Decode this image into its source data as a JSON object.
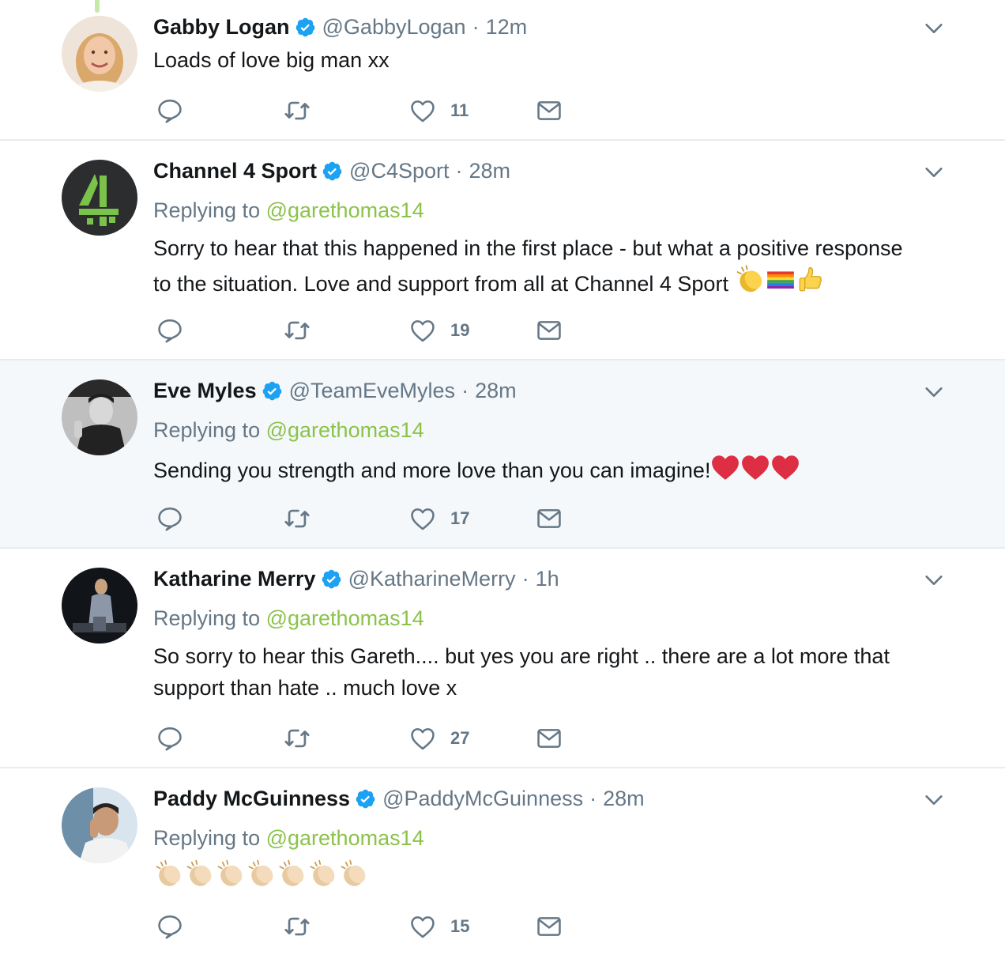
{
  "tweets": [
    {
      "name": "Gabby Logan",
      "handle": "@GabbyLogan",
      "separator": "·",
      "time": "12m",
      "replying_prefix": "",
      "replying_to": "",
      "text": "Loads of love big man xx",
      "emojis": [],
      "likes": "11",
      "avatar": "woman-smiling-photo"
    },
    {
      "name": "Channel 4 Sport",
      "handle": "@C4Sport",
      "separator": "·",
      "time": "28m",
      "replying_prefix": "Replying to",
      "replying_to": "@garethomas14",
      "text_line1": "Sorry to hear that this happened in the first place - but what a positive response",
      "text_line2": "to the situation. Love and support from all at Channel 4 Sport",
      "emojis": [
        "clapping-hands",
        "rainbow-flag",
        "thumbs-up"
      ],
      "likes": "19",
      "avatar": "channel-4-logo"
    },
    {
      "name": "Eve Myles",
      "handle": "@TeamEveMyles",
      "separator": "·",
      "time": "28m",
      "replying_prefix": "Replying to",
      "replying_to": "@garethomas14",
      "text": "Sending you strength and more love than you can imagine!",
      "emojis": [
        "red-heart",
        "red-heart",
        "red-heart"
      ],
      "likes": "17",
      "avatar": "man-bw-photo"
    },
    {
      "name": "Katharine Merry",
      "handle": "@KatharineMerry",
      "separator": "·",
      "time": "1h",
      "replying_prefix": "Replying to",
      "replying_to": "@garethomas14",
      "text_line1": "So sorry to hear this Gareth.... but yes you are right .. there are a lot more that",
      "text_line2": "support than hate .. much love x",
      "emojis": [],
      "likes": "27",
      "avatar": "woman-stage-photo"
    },
    {
      "name": "Paddy McGuinness",
      "handle": "@PaddyMcGuinness",
      "separator": "·",
      "time": "28m",
      "replying_prefix": "Replying to",
      "replying_to": "@garethomas14",
      "text": "",
      "emojis": [
        "clapping-hands",
        "clapping-hands",
        "clapping-hands",
        "clapping-hands",
        "clapping-hands",
        "clapping-hands",
        "clapping-hands"
      ],
      "likes": "15",
      "avatar": "man-selfie-photo"
    }
  ],
  "colors": {
    "verified": "#1da1f2",
    "mention": "#8bc34a",
    "muted": "#657786",
    "divider": "#e6ecf0",
    "highlight_bg": "#f5f8fa"
  },
  "icons": [
    "reply-icon",
    "retweet-icon",
    "like-icon",
    "direct-message-icon",
    "verified-badge-icon",
    "chevron-down-icon"
  ]
}
